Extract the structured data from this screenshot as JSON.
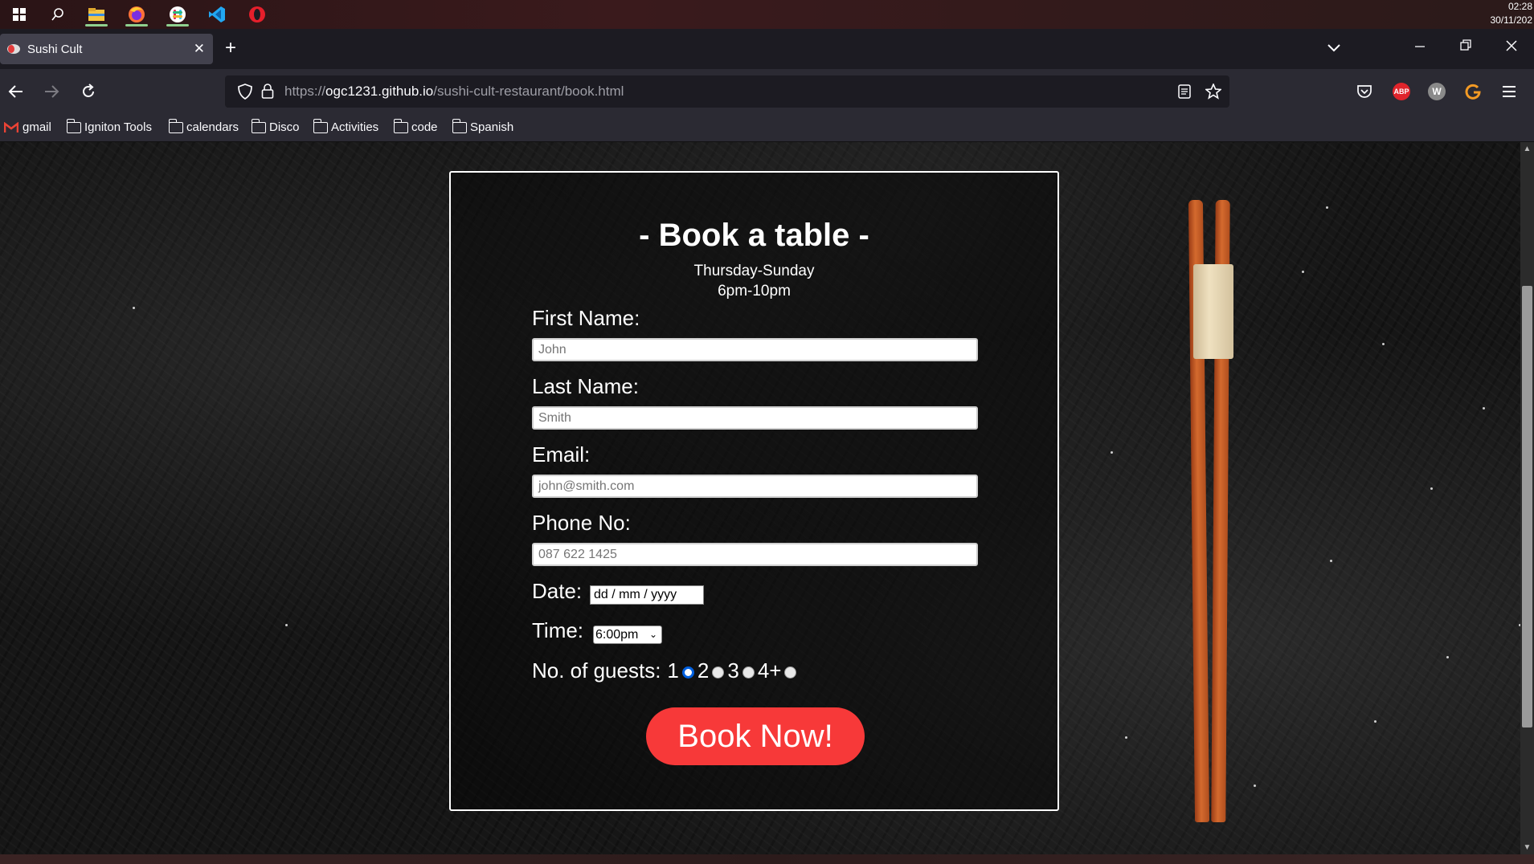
{
  "taskbar": {
    "clock_time": "02:28",
    "clock_date": "30/11/202"
  },
  "browser": {
    "tab_title": "Sushi Cult",
    "url_prefix": "https://",
    "url_host": "ogc1231.github.io",
    "url_path": "/sushi-cult-restaurant/book.html",
    "bookmarks": [
      "gmail",
      "Igniton Tools",
      "calendars",
      "Disco",
      "Activities",
      "code",
      "Spanish"
    ],
    "extensions": {
      "abp": "ABP",
      "w": "W"
    }
  },
  "booking": {
    "title": "- Book a table -",
    "days": "Thursday-Sunday",
    "hours": "6pm-10pm",
    "first_name_label": "First Name:",
    "first_name_placeholder": "John",
    "last_name_label": "Last Name:",
    "last_name_placeholder": "Smith",
    "email_label": "Email:",
    "email_placeholder": "john@smith.com",
    "phone_label": "Phone No:",
    "phone_placeholder": "087 622 1425",
    "date_label": "Date:",
    "date_placeholder": "dd / mm / yyyy",
    "time_label": "Time:",
    "time_value": "6:00pm",
    "guests_label": "No. of guests:",
    "guest_options": [
      "1",
      "2",
      "3",
      "4+"
    ],
    "guest_selected": "1",
    "submit_label": "Book Now!"
  },
  "colors": {
    "accent_button": "#f73939",
    "radio_checked": "#0060df"
  }
}
